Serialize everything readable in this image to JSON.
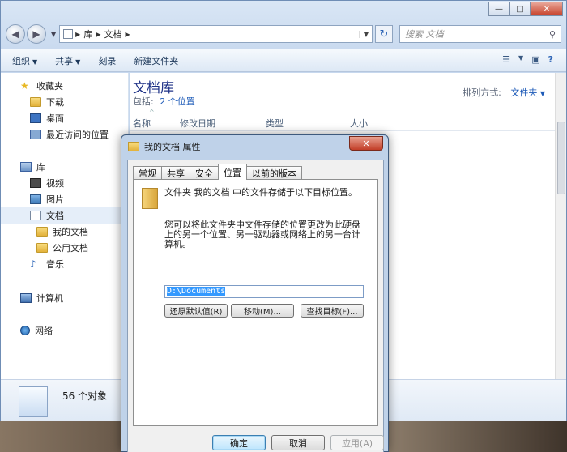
{
  "explorer": {
    "window_controls": {
      "minimize": "—",
      "maximize": "□",
      "close": "✕"
    },
    "address": {
      "segments": [
        "库",
        "文档"
      ]
    },
    "search": {
      "placeholder": "搜索 文档"
    },
    "toolbar": {
      "organize": "组织",
      "share": "共享",
      "burn": "刻录",
      "new_folder": "新建文件夹"
    },
    "sidebar": {
      "favorites": "收藏夹",
      "downloads": "下载",
      "desktop": "桌面",
      "recent": "最近访问的位置",
      "libraries": "库",
      "videos": "视频",
      "pictures": "图片",
      "documents": "文档",
      "my_documents": "我的文档",
      "public_documents": "公用文档",
      "music": "音乐",
      "computer": "计算机",
      "network": "网络"
    },
    "main": {
      "title": "文档库",
      "includes_label": "包括:",
      "includes_link": "2 个位置",
      "arrange_label": "排列方式:",
      "arrange_value": "文件夹",
      "columns": [
        "名称",
        "修改日期",
        "类型",
        "大小"
      ]
    },
    "details": {
      "count": "56 个对象"
    }
  },
  "dialog": {
    "title": "我的文档 属性",
    "close": "✕",
    "tabs": [
      "常规",
      "共享",
      "安全",
      "位置",
      "以前的版本"
    ],
    "active_tab": "位置",
    "line1": "文件夹 我的文档 中的文件存储于以下目标位置。",
    "line2": "您可以将此文件夹中文件存储的位置更改为此硬盘上的另一个位置、另一驱动器或网络上的另一台计算机。",
    "path": "D:\\Documents",
    "buttons": {
      "restore": "还原默认值(R)",
      "move": "移动(M)...",
      "find_target": "查找目标(F)...",
      "ok": "确定",
      "cancel": "取消",
      "apply": "应用(A)"
    }
  }
}
